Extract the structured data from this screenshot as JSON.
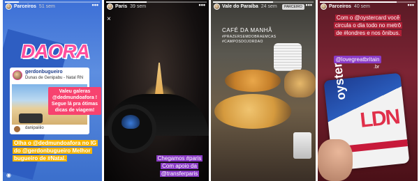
{
  "stories": [
    {
      "user": "Parceiros",
      "time": "51 sem",
      "progress": 0.15,
      "sticker_title": "DAORA",
      "post": {
        "username": "gerdonbugueiro",
        "location": "Dunas de Genipabu - Natal RN",
        "footer_user": "danipaiiiio"
      },
      "bubble": "Valeu galeras @dedmundoafora ! Segue lá pra ótimas dicas de viagem!",
      "caption": "Olha o @dedmundoafora no IG do @gerdonbugueiro Melhor bugueiro de #Natal."
    },
    {
      "user": "Paris",
      "time": "39 sem",
      "progress": 0.4,
      "close_icon": "×",
      "caption": "Chegamos #paris Com apoio da @transferparis"
    },
    {
      "user": "Vale do Paraíba",
      "time": "24 sem",
      "progress": 0.6,
      "badge": "PARCEIRO",
      "caption": "CAFÉ DA MANHÃ",
      "hashtags": "#PRAZERSEMDOBRAEMCAS\n#CAMPOSDOJORDAO"
    },
    {
      "user": "Parceiros",
      "time": "40 sem",
      "progress": 0.8,
      "caption": "Com o @oystercard você circula o dia todo no metrô de #londres e nos ônibus.",
      "mention": "@lovegreatbritain",
      "mention_suffix": ".br",
      "card_brand": "oyster",
      "card_city": "LDN"
    }
  ],
  "icons": {
    "camera": "camera-icon",
    "more": "more-options-icon"
  }
}
